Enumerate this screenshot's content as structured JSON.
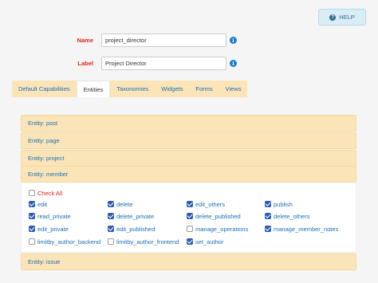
{
  "help": {
    "label": "HELP"
  },
  "form": {
    "name": {
      "label": "Name",
      "value": "project_director"
    },
    "label": {
      "label": "Label",
      "value": "Project Director"
    }
  },
  "tabs": [
    {
      "label": "Default Capabilities",
      "active": false
    },
    {
      "label": "Entities",
      "active": true
    },
    {
      "label": "Taxonomies",
      "active": false
    },
    {
      "label": "Widgets",
      "active": false
    },
    {
      "label": "Forms",
      "active": false
    },
    {
      "label": "Views",
      "active": false
    }
  ],
  "panels": {
    "post": "Entity: post",
    "page": "Entity: page",
    "project": "Entity: project",
    "member": "Entity: member",
    "issue": "Entity: issue"
  },
  "member": {
    "check_all": "Check All",
    "capabilities": [
      {
        "label": "edit",
        "checked": true
      },
      {
        "label": "delete",
        "checked": true
      },
      {
        "label": "edit_others",
        "checked": true
      },
      {
        "label": "publish",
        "checked": true
      },
      {
        "label": "read_private",
        "checked": true
      },
      {
        "label": "delete_private",
        "checked": true
      },
      {
        "label": "delete_published",
        "checked": true
      },
      {
        "label": "delete_others",
        "checked": true
      },
      {
        "label": "edit_private",
        "checked": true
      },
      {
        "label": "edit_published",
        "checked": true
      },
      {
        "label": "manage_operations",
        "checked": false
      },
      {
        "label": "manage_member_notes",
        "checked": true
      },
      {
        "label": "limitby_author_backend",
        "checked": false
      },
      {
        "label": "limitby_author_frontend",
        "checked": false
      },
      {
        "label": "set_author",
        "checked": true
      }
    ]
  },
  "colors": {
    "accent": "#1a6fb5",
    "required": "#d9261c",
    "panel_bg": "#fbe5b8",
    "checkbox_checked": "#2a5db0"
  }
}
